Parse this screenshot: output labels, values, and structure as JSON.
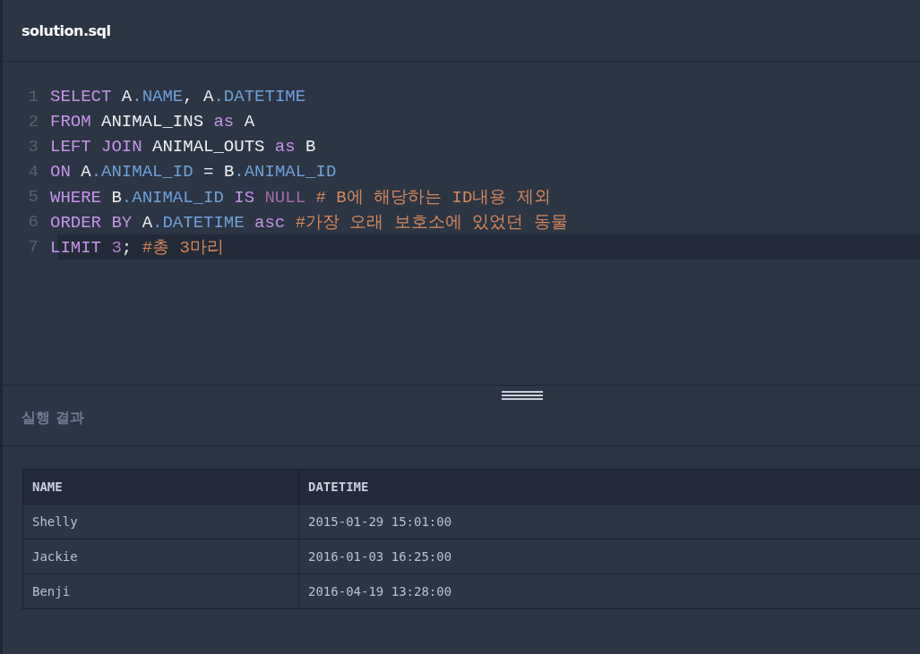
{
  "file_tab": {
    "title": "solution.sql"
  },
  "code_lines": [
    {
      "number": "1",
      "current": false,
      "tokens": [
        {
          "text": "SELECT ",
          "kind": "keyword"
        },
        {
          "text": "A",
          "kind": "plain"
        },
        {
          "text": ".NAME",
          "kind": "property"
        },
        {
          "text": ", ",
          "kind": "plain"
        },
        {
          "text": "A",
          "kind": "plain"
        },
        {
          "text": ".DATETIME",
          "kind": "property"
        }
      ]
    },
    {
      "number": "2",
      "current": false,
      "tokens": [
        {
          "text": "FROM ",
          "kind": "keyword"
        },
        {
          "text": "ANIMAL_INS ",
          "kind": "plain"
        },
        {
          "text": "as ",
          "kind": "keyword"
        },
        {
          "text": "A",
          "kind": "plain"
        }
      ]
    },
    {
      "number": "3",
      "current": false,
      "tokens": [
        {
          "text": "LEFT JOIN ",
          "kind": "keyword"
        },
        {
          "text": "ANIMAL_OUTS ",
          "kind": "plain"
        },
        {
          "text": "as ",
          "kind": "keyword"
        },
        {
          "text": "B",
          "kind": "plain"
        }
      ]
    },
    {
      "number": "4",
      "current": false,
      "tokens": [
        {
          "text": "ON ",
          "kind": "keyword"
        },
        {
          "text": "A",
          "kind": "plain"
        },
        {
          "text": ".ANIMAL_ID",
          "kind": "property"
        },
        {
          "text": " = ",
          "kind": "plain"
        },
        {
          "text": "B",
          "kind": "plain"
        },
        {
          "text": ".ANIMAL_ID",
          "kind": "property"
        }
      ]
    },
    {
      "number": "5",
      "current": false,
      "tokens": [
        {
          "text": "WHERE ",
          "kind": "keyword"
        },
        {
          "text": "B",
          "kind": "plain"
        },
        {
          "text": ".ANIMAL_ID ",
          "kind": "property"
        },
        {
          "text": "IS ",
          "kind": "keyword"
        },
        {
          "text": "NULL ",
          "kind": "constant"
        },
        {
          "text": "# B에 해당하는 ID내용 제외",
          "kind": "comment"
        }
      ]
    },
    {
      "number": "6",
      "current": false,
      "tokens": [
        {
          "text": "ORDER BY ",
          "kind": "keyword"
        },
        {
          "text": "A",
          "kind": "plain"
        },
        {
          "text": ".DATETIME ",
          "kind": "property"
        },
        {
          "text": "asc ",
          "kind": "keyword"
        },
        {
          "text": "#가장 오래 보호소에 있었던 동물",
          "kind": "comment"
        }
      ]
    },
    {
      "number": "7",
      "current": true,
      "tokens": [
        {
          "text": "LIMIT ",
          "kind": "keyword"
        },
        {
          "text": "3",
          "kind": "number"
        },
        {
          "text": "; ",
          "kind": "plain"
        },
        {
          "text": "#총 3마리",
          "kind": "comment"
        }
      ]
    }
  ],
  "results": {
    "title": "실행 결과",
    "columns": [
      "NAME",
      "DATETIME"
    ],
    "rows": [
      [
        "Shelly",
        "2015-01-29 15:01:00"
      ],
      [
        "Jackie",
        "2016-01-03 16:25:00"
      ],
      [
        "Benji",
        "2016-04-19 13:28:00"
      ]
    ]
  }
}
